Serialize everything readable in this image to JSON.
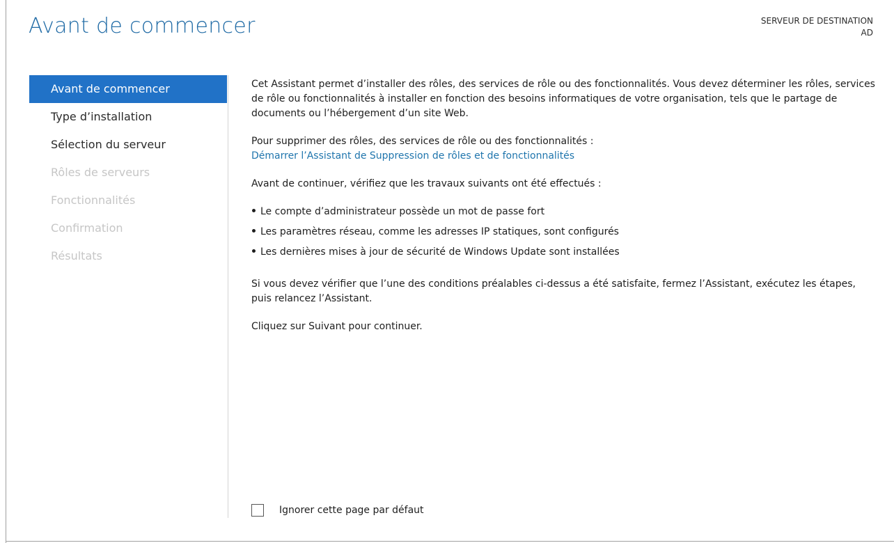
{
  "header": {
    "title": "Avant de commencer",
    "destination_label": "SERVEUR DE DESTINATION",
    "destination_value": "AD"
  },
  "nav": {
    "items": [
      {
        "label": "Avant de commencer",
        "state": "active"
      },
      {
        "label": "Type d’installation",
        "state": "enabled"
      },
      {
        "label": "Sélection du serveur",
        "state": "enabled"
      },
      {
        "label": "Rôles de serveurs",
        "state": "disabled"
      },
      {
        "label": "Fonctionnalités",
        "state": "disabled"
      },
      {
        "label": "Confirmation",
        "state": "disabled"
      },
      {
        "label": "Résultats",
        "state": "disabled"
      }
    ]
  },
  "content": {
    "intro": "Cet Assistant permet d’installer des rôles, des services de rôle ou des fonctionnalités. Vous devez déterminer les rôles, services de rôle ou fonctionnalités à installer en fonction des besoins informatiques de votre organisation, tels que le partage de documents ou l’hébergement d’un site Web.",
    "remove_text": "Pour supprimer des rôles, des services de rôle ou des fonctionnalités :",
    "remove_link": "Démarrer l’Assistant de Suppression de rôles et de fonctionnalités",
    "before_text": "Avant de continuer, vérifiez que les travaux suivants ont été effectués :",
    "bullets": [
      "Le compte d’administrateur possède un mot de passe fort",
      "Les paramètres réseau, comme les adresses IP statiques, sont configurés",
      "Les dernières mises à jour de sécurité de Windows Update sont installées"
    ],
    "check_text": "Si vous devez vérifier que l’une des conditions préalables ci-dessus a été satisfaite, fermez l’Assistant, exécutez les étapes, puis relancez l’Assistant.",
    "next_text": "Cliquez sur Suivant pour continuer."
  },
  "footer": {
    "skip_label": "Ignorer cette page par défaut",
    "skip_checked": false
  },
  "colors": {
    "accent": "#2172c7",
    "title": "#1f6aa5",
    "link": "#1f75ad",
    "disabled_text": "#c6c6c6"
  }
}
